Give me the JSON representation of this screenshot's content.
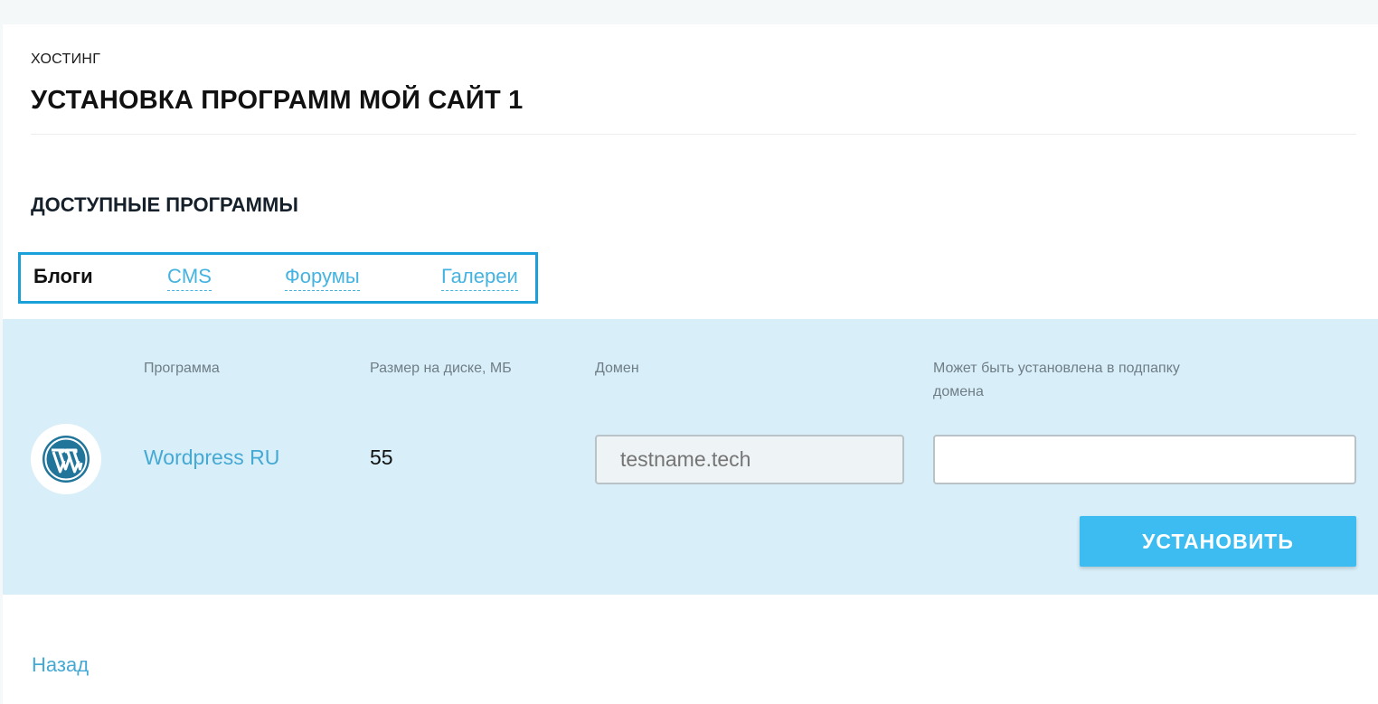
{
  "breadcrumb": "ХОСТИНГ",
  "title": "УСТАНОВКА ПРОГРАММ МОЙ САЙТ 1",
  "section_title": "ДОСТУПНЫЕ ПРОГРАММЫ",
  "tabs": [
    {
      "label": "Блоги",
      "active": true
    },
    {
      "label": "CMS",
      "active": false
    },
    {
      "label": "Форумы",
      "active": false
    },
    {
      "label": "Галереи",
      "active": false
    }
  ],
  "table": {
    "headers": {
      "program": "Программа",
      "size": "Размер на диске, МБ",
      "domain": "Домен",
      "subfolder_line1": "Может быть установлена в подпапку",
      "subfolder_line2": "домена"
    },
    "row": {
      "logo_icon": "wordpress-logo-icon",
      "program": "Wordpress RU",
      "size": "55",
      "domain_placeholder": "testname.tech",
      "subfolder_value": ""
    }
  },
  "install_button": "УСТАНОВИТЬ",
  "back_link": "Назад",
  "colors": {
    "accent": "#3cbcf0",
    "link": "#45a9d4",
    "tabs_border": "#1aa0d8",
    "panel_bg": "#d8eff9",
    "wordpress_blue": "#21759b"
  }
}
